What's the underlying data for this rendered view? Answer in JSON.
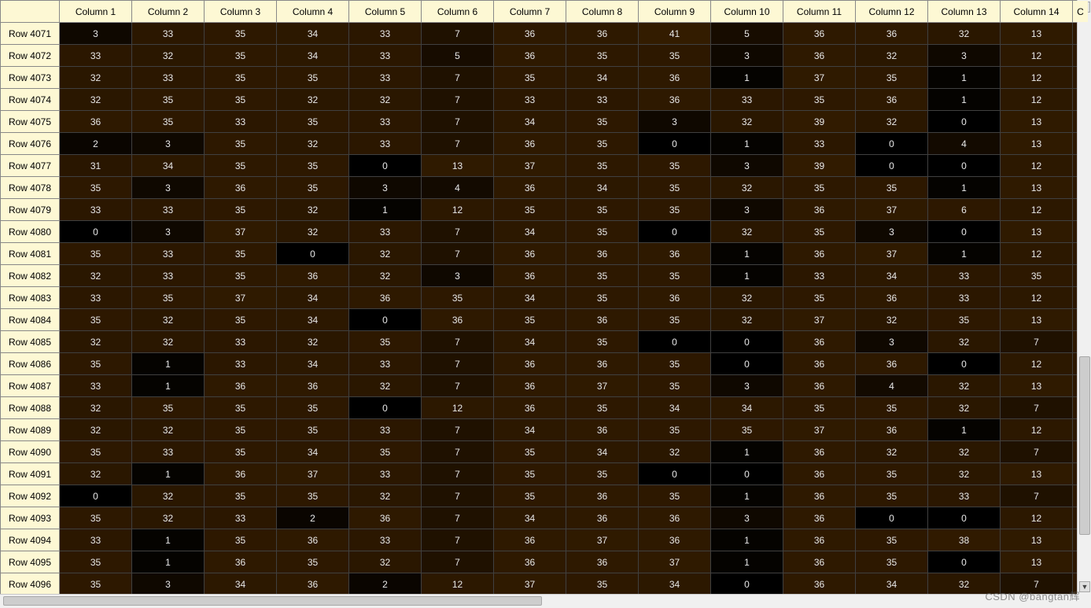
{
  "columns": [
    "Column 1",
    "Column 2",
    "Column 3",
    "Column 4",
    "Column 5",
    "Column 6",
    "Column 7",
    "Column 8",
    "Column 9",
    "Column 10",
    "Column 11",
    "Column 12",
    "Column 13",
    "Column 14"
  ],
  "partial_col": "C",
  "rows": [
    {
      "label": "Row 4071",
      "cells": [
        3,
        33,
        35,
        34,
        33,
        7,
        36,
        36,
        41,
        5,
        36,
        36,
        32,
        13
      ]
    },
    {
      "label": "Row 4072",
      "cells": [
        33,
        32,
        35,
        34,
        33,
        5,
        36,
        35,
        35,
        3,
        36,
        32,
        3,
        12
      ]
    },
    {
      "label": "Row 4073",
      "cells": [
        32,
        33,
        35,
        35,
        33,
        7,
        35,
        34,
        36,
        1,
        37,
        35,
        1,
        12
      ]
    },
    {
      "label": "Row 4074",
      "cells": [
        32,
        35,
        35,
        32,
        32,
        7,
        33,
        33,
        36,
        33,
        35,
        36,
        1,
        12
      ]
    },
    {
      "label": "Row 4075",
      "cells": [
        36,
        35,
        33,
        35,
        33,
        7,
        34,
        35,
        3,
        32,
        39,
        32,
        0,
        13
      ]
    },
    {
      "label": "Row 4076",
      "cells": [
        2,
        3,
        35,
        32,
        33,
        7,
        36,
        35,
        0,
        1,
        33,
        0,
        4,
        13
      ]
    },
    {
      "label": "Row 4077",
      "cells": [
        31,
        34,
        35,
        35,
        0,
        13,
        37,
        35,
        35,
        3,
        39,
        0,
        0,
        12
      ]
    },
    {
      "label": "Row 4078",
      "cells": [
        35,
        3,
        36,
        35,
        3,
        4,
        36,
        34,
        35,
        32,
        35,
        35,
        1,
        13
      ]
    },
    {
      "label": "Row 4079",
      "cells": [
        33,
        33,
        35,
        32,
        1,
        12,
        35,
        35,
        35,
        3,
        36,
        37,
        6,
        12
      ]
    },
    {
      "label": "Row 4080",
      "cells": [
        0,
        3,
        37,
        32,
        33,
        7,
        34,
        35,
        0,
        32,
        35,
        3,
        0,
        13
      ]
    },
    {
      "label": "Row 4081",
      "cells": [
        35,
        33,
        35,
        0,
        32,
        7,
        36,
        36,
        36,
        1,
        36,
        37,
        1,
        12
      ]
    },
    {
      "label": "Row 4082",
      "cells": [
        32,
        33,
        35,
        36,
        32,
        3,
        36,
        35,
        35,
        1,
        33,
        34,
        33,
        35
      ]
    },
    {
      "label": "Row 4083",
      "cells": [
        33,
        35,
        37,
        34,
        36,
        35,
        34,
        35,
        36,
        32,
        35,
        36,
        33,
        12
      ]
    },
    {
      "label": "Row 4084",
      "cells": [
        35,
        32,
        35,
        34,
        0,
        36,
        35,
        36,
        35,
        32,
        37,
        32,
        35,
        13
      ]
    },
    {
      "label": "Row 4085",
      "cells": [
        32,
        32,
        33,
        32,
        35,
        7,
        34,
        35,
        0,
        0,
        36,
        3,
        32,
        7
      ]
    },
    {
      "label": "Row 4086",
      "cells": [
        35,
        1,
        33,
        34,
        33,
        7,
        36,
        36,
        35,
        0,
        36,
        36,
        0,
        12
      ]
    },
    {
      "label": "Row 4087",
      "cells": [
        33,
        1,
        36,
        36,
        32,
        7,
        36,
        37,
        35,
        3,
        36,
        4,
        32,
        13
      ]
    },
    {
      "label": "Row 4088",
      "cells": [
        32,
        35,
        35,
        35,
        0,
        12,
        36,
        35,
        34,
        34,
        35,
        35,
        32,
        7
      ]
    },
    {
      "label": "Row 4089",
      "cells": [
        32,
        32,
        35,
        35,
        33,
        7,
        34,
        36,
        35,
        35,
        37,
        36,
        1,
        12
      ]
    },
    {
      "label": "Row 4090",
      "cells": [
        35,
        33,
        35,
        34,
        35,
        7,
        35,
        34,
        32,
        1,
        36,
        32,
        32,
        7
      ]
    },
    {
      "label": "Row 4091",
      "cells": [
        32,
        1,
        36,
        37,
        33,
        7,
        35,
        35,
        0,
        0,
        36,
        35,
        32,
        13
      ]
    },
    {
      "label": "Row 4092",
      "cells": [
        0,
        32,
        35,
        35,
        32,
        7,
        35,
        36,
        35,
        1,
        36,
        35,
        33,
        7
      ]
    },
    {
      "label": "Row 4093",
      "cells": [
        35,
        32,
        33,
        2,
        36,
        7,
        34,
        36,
        36,
        3,
        36,
        0,
        0,
        12
      ]
    },
    {
      "label": "Row 4094",
      "cells": [
        33,
        1,
        35,
        36,
        33,
        7,
        36,
        37,
        36,
        1,
        36,
        35,
        38,
        13
      ]
    },
    {
      "label": "Row 4095",
      "cells": [
        35,
        1,
        36,
        35,
        32,
        7,
        36,
        36,
        37,
        1,
        36,
        35,
        0,
        13
      ]
    },
    {
      "label": "Row 4096",
      "cells": [
        35,
        3,
        34,
        36,
        2,
        12,
        37,
        35,
        34,
        0,
        36,
        34,
        32,
        7
      ]
    }
  ],
  "watermark": "CSDN @bangtan辉"
}
